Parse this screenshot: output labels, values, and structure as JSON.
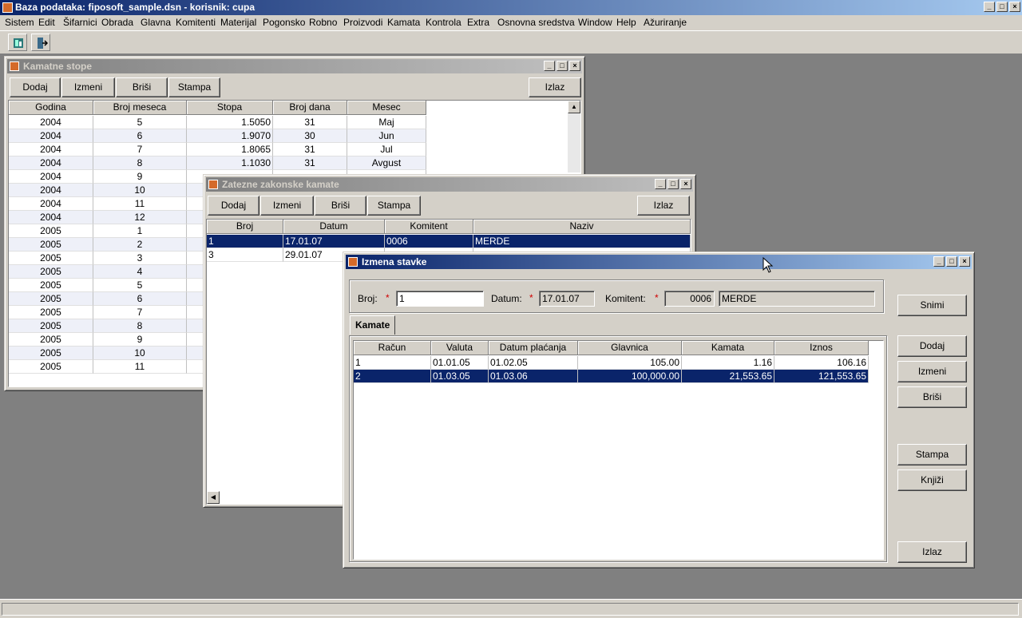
{
  "app": {
    "title": "Baza podataka: fiposoft_sample.dsn  -  korisnik: cupa",
    "menu": [
      "Sistem",
      "Edit",
      "Šifarnici",
      "Obrada",
      "Glavna",
      "Komitenti",
      "Materijal",
      "Pogonsko",
      "Robno",
      "Proizvodi",
      "Kamata",
      "Kontrola",
      "Extra",
      "Osnovna sredstva",
      "Window",
      "Help",
      "Ažuriranje"
    ],
    "caption_buttons": [
      "_",
      "□",
      "×"
    ]
  },
  "kamatne": {
    "title": "Kamatne stope",
    "buttons": {
      "add": "Dodaj",
      "edit": "Izmeni",
      "delete": "Briši",
      "print": "Stampa",
      "exit": "Izlaz"
    },
    "columns": [
      "Godina",
      "Broj meseca",
      "Stopa",
      "Broj dana",
      "Mesec"
    ],
    "rows": [
      [
        "2004",
        "5",
        "1.5050",
        "31",
        "Maj"
      ],
      [
        "2004",
        "6",
        "1.9070",
        "30",
        "Jun"
      ],
      [
        "2004",
        "7",
        "1.8065",
        "31",
        "Jul"
      ],
      [
        "2004",
        "8",
        "1.1030",
        "31",
        "Avgust"
      ],
      [
        "2004",
        "9",
        "",
        "",
        ""
      ],
      [
        "2004",
        "10",
        "",
        "",
        ""
      ],
      [
        "2004",
        "11",
        "",
        "",
        ""
      ],
      [
        "2004",
        "12",
        "",
        "",
        ""
      ],
      [
        "2005",
        "1",
        "",
        "",
        ""
      ],
      [
        "2005",
        "2",
        "",
        "",
        ""
      ],
      [
        "2005",
        "3",
        "",
        "",
        ""
      ],
      [
        "2005",
        "4",
        "",
        "",
        ""
      ],
      [
        "2005",
        "5",
        "",
        "",
        ""
      ],
      [
        "2005",
        "6",
        "",
        "",
        ""
      ],
      [
        "2005",
        "7",
        "",
        "",
        ""
      ],
      [
        "2005",
        "8",
        "",
        "",
        ""
      ],
      [
        "2005",
        "9",
        "",
        "",
        ""
      ],
      [
        "2005",
        "10",
        "",
        "",
        ""
      ],
      [
        "2005",
        "11",
        "",
        "",
        ""
      ]
    ]
  },
  "zatezne": {
    "title": "Zatezne zakonske kamate",
    "buttons": {
      "add": "Dodaj",
      "edit": "Izmeni",
      "delete": "Briši",
      "print": "Stampa",
      "exit": "Izlaz"
    },
    "columns": [
      "Broj",
      "Datum",
      "Komitent",
      "Naziv"
    ],
    "rows": [
      [
        "1",
        "17.01.07",
        "0006",
        "MERDE"
      ],
      [
        "3",
        "29.01.07",
        "",
        ""
      ]
    ]
  },
  "izmena": {
    "title": "Izmena stavke",
    "broj_label": "Broj:",
    "broj_value": "1",
    "datum_label": "Datum:",
    "datum_value": "17.01.07",
    "komitent_label": "Komitent:",
    "komitent_code": "0006",
    "komitent_name": "MERDE",
    "required_mark": "*",
    "tab_label": "Kamate",
    "columns": [
      "Račun",
      "Valuta",
      "Datum plaćanja",
      "Glavnica",
      "Kamata",
      "Iznos"
    ],
    "rows": [
      [
        "1",
        "01.01.05",
        "01.02.05",
        "105.00",
        "1.16",
        "106.16"
      ],
      [
        "2",
        "01.03.05",
        "01.03.06",
        "100,000.00",
        "21,553.65",
        "121,553.65"
      ]
    ],
    "buttons": {
      "save": "Snimi",
      "add": "Dodaj",
      "edit": "Izmeni",
      "delete": "Briši",
      "print": "Stampa",
      "post": "Knjiži",
      "exit": "Izlaz"
    }
  }
}
